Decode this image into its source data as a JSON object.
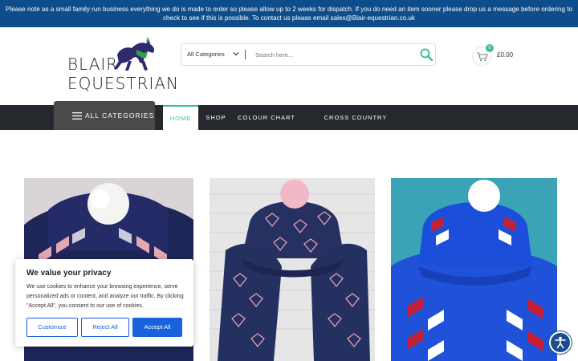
{
  "notice": {
    "line1": "Please note as a small family run business everything we do is made to order so please allow up to 2 weeks for dispatch. If you do need an item sooner please drop us a message before ordering to",
    "line2": "check to see if this is possible. To contact us please email sales@Blair-equestrian.co.uk"
  },
  "logo": {
    "line1": "BLAIR",
    "line2": "EQUESTRIAN"
  },
  "search": {
    "category": "All Categories",
    "placeholder": "Search here..."
  },
  "cart": {
    "count": "0",
    "total": "£0.00"
  },
  "nav": {
    "all_categories": "ALL CATEGORIES",
    "items": [
      "HOME",
      "SHOP",
      "COLOUR CHART",
      "CROSS COUNTRY INSPIRATION"
    ]
  },
  "cookie": {
    "title": "We value your privacy",
    "text": "We use cookies to enhance your browsing experience, serve personalized ads or content, and analyze our traffic. By clicking \"Accept All\", you consent to our use of cookies.",
    "customize": "Customize",
    "reject": "Reject All",
    "accept": "Accept All"
  },
  "colors": {
    "notice_bg": "#0e4c8a",
    "nav_bg": "#25282c",
    "accent": "#3fbf8f",
    "cookie_btn": "#1863dc"
  },
  "icons": [
    "chevron-down-icon",
    "search-icon",
    "cart-icon",
    "menu-icon",
    "accessibility-icon"
  ]
}
